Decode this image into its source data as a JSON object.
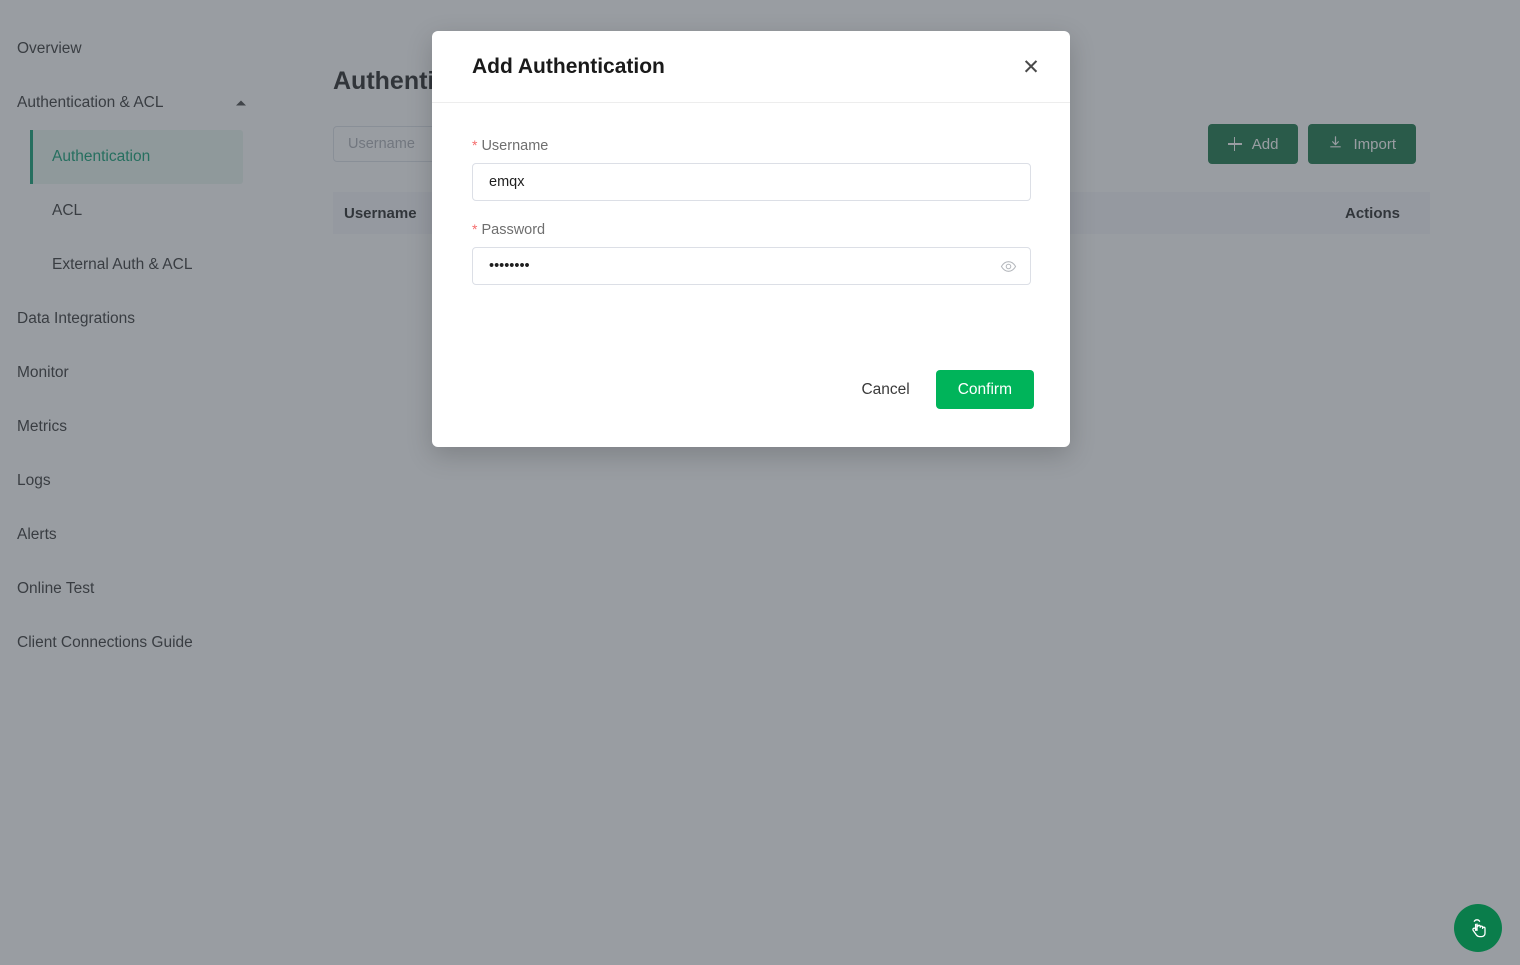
{
  "sidebar": {
    "items": [
      {
        "label": "Overview",
        "type": "link"
      },
      {
        "label": "Authentication & ACL",
        "type": "group",
        "expanded": true
      },
      {
        "label": "Authentication",
        "type": "sub",
        "active": true
      },
      {
        "label": "ACL",
        "type": "sub",
        "active": false
      },
      {
        "label": "External Auth & ACL",
        "type": "sub",
        "active": false
      },
      {
        "label": "Data Integrations",
        "type": "link"
      },
      {
        "label": "Monitor",
        "type": "link"
      },
      {
        "label": "Metrics",
        "type": "link"
      },
      {
        "label": "Logs",
        "type": "link"
      },
      {
        "label": "Alerts",
        "type": "link"
      },
      {
        "label": "Online Test",
        "type": "link"
      },
      {
        "label": "Client Connections Guide",
        "type": "link"
      }
    ],
    "active_accent": "#00996b",
    "active_bg": "#e9f5f0"
  },
  "page": {
    "title": "Authentication",
    "search": {
      "placeholder": "Username",
      "value": ""
    },
    "actions": {
      "add_label": "Add",
      "add_icon": "plus-icon",
      "import_label": "Import",
      "import_icon": "download-icon",
      "button_color": "#0a6e3d"
    },
    "table": {
      "columns": [
        "Username",
        "Actions"
      ],
      "rows": []
    }
  },
  "modal": {
    "title": "Add Authentication",
    "close_icon": "close-icon",
    "fields": [
      {
        "label": "Username",
        "required": true,
        "value": "emqx",
        "placeholder": "",
        "type": "text"
      },
      {
        "label": "Password",
        "required": true,
        "value": "••••••••",
        "placeholder": "",
        "type": "password",
        "toggle_icon": "eye-icon"
      }
    ],
    "cancel_label": "Cancel",
    "confirm_label": "Confirm",
    "confirm_color": "#00b45a",
    "required_marker": "*"
  },
  "fab": {
    "icon": "click-hand-icon",
    "color": "#0a7d4b"
  }
}
